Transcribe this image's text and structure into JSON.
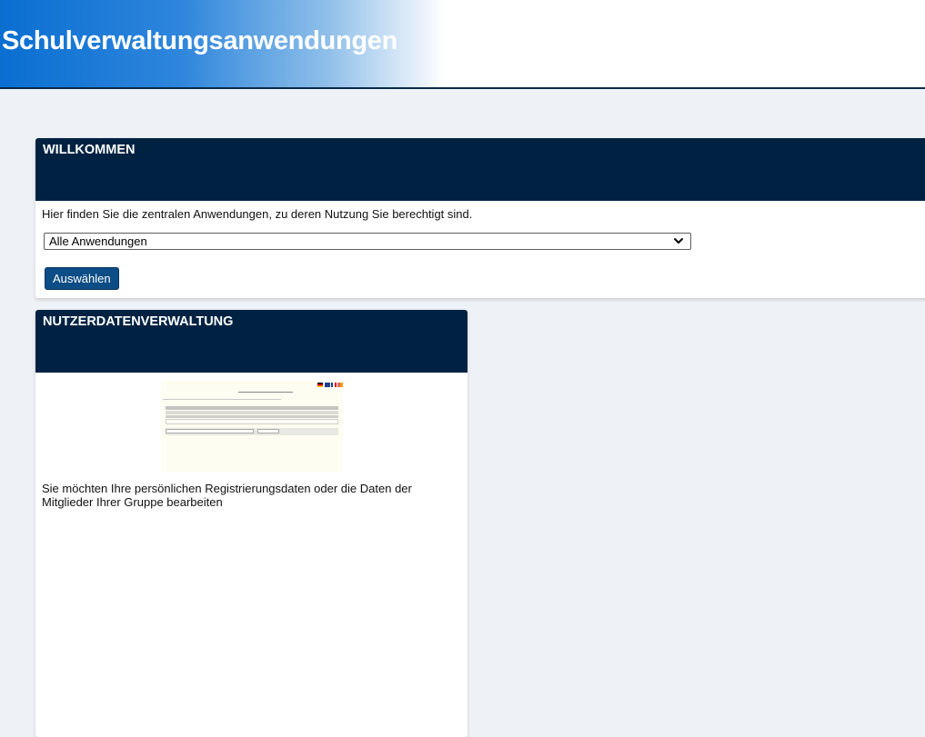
{
  "header": {
    "title": "Schulverwaltungsanwendungen"
  },
  "welcome": {
    "title": "WILLKOMMEN",
    "text": "Hier finden Sie die zentralen Anwendungen, zu deren Nutzung Sie berechtigt sind.",
    "select_value": "Alle Anwendungen",
    "button_label": "Auswählen"
  },
  "user_admin": {
    "title": "NUTZERDATENVERWALTUNG",
    "description": "Sie möchten Ihre persönlichen Registrierungsdaten oder die Daten der Mitglieder Ihrer Gruppe bearbeiten",
    "thumbnail_icon": "application-preview-image"
  },
  "colors": {
    "header_gradient_start": "#0a6fd1",
    "card_header": "#002242",
    "button": "#0c4d86",
    "page_background": "#eef2f6"
  }
}
